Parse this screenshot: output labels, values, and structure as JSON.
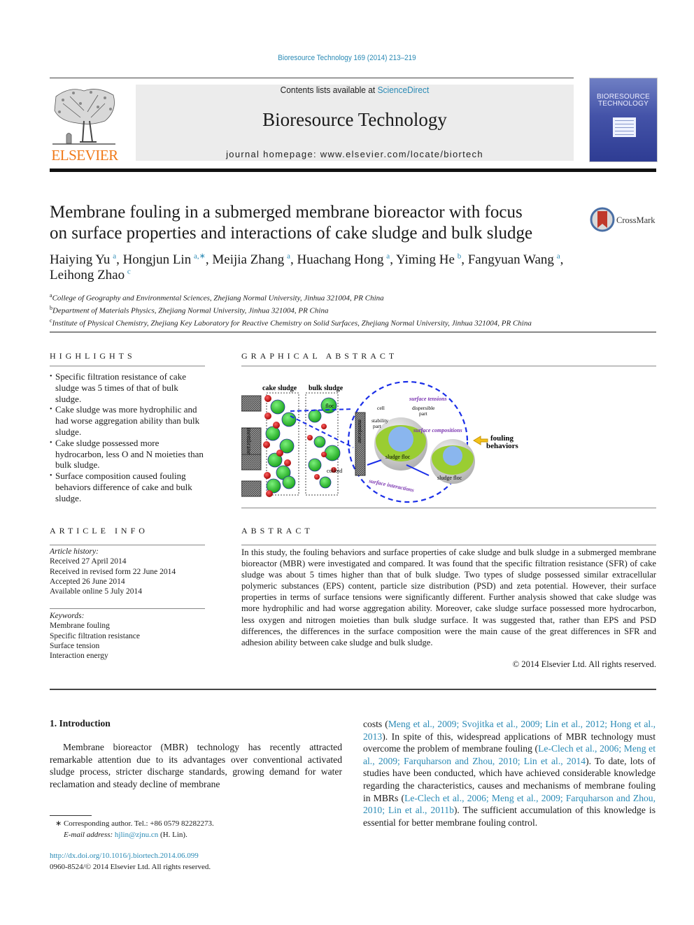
{
  "header": {
    "journal_reference": "Bioresource Technology 169 (2014) 213–219",
    "contents_prefix": "Contents lists available at ",
    "contents_link": "ScienceDirect",
    "journal_title": "Bioresource Technology",
    "homepage": "journal homepage: www.elsevier.com/locate/biortech",
    "publisher_logo": "ELSEVIER",
    "cover_title_line1": "BIORESOURCE",
    "cover_title_line2": "TECHNOLOGY",
    "crossmark_label": "CrossMark"
  },
  "article": {
    "title_line1": "Membrane fouling in a submerged membrane bioreactor with focus",
    "title_line2": "on surface properties and interactions of cake sludge and bulk sludge",
    "authors": [
      {
        "name": "Haiying Yu",
        "sup": "a"
      },
      {
        "name": "Hongjun Lin",
        "sup": "a,∗"
      },
      {
        "name": "Meijia Zhang",
        "sup": "a"
      },
      {
        "name": "Huachang Hong",
        "sup": "a"
      },
      {
        "name": "Yiming He",
        "sup": "b"
      },
      {
        "name": "Fangyuan Wang",
        "sup": "a"
      },
      {
        "name": "Leihong Zhao",
        "sup": "c"
      }
    ],
    "affiliations": [
      {
        "sup": "a",
        "text": "College of Geography and Environmental Sciences, Zhejiang Normal University, Jinhua 321004, PR China"
      },
      {
        "sup": "b",
        "text": "Department of Materials Physics, Zhejiang Normal University, Jinhua 321004, PR China"
      },
      {
        "sup": "c",
        "text": "Institute of Physical Chemistry, Zhejiang Key Laboratory for Reactive Chemistry on Solid Surfaces, Zhejiang Normal University, Jinhua 321004, PR China"
      }
    ]
  },
  "highlights": {
    "heading": "HIGHLIGHTS",
    "items": [
      "Specific filtration resistance of cake sludge was 5 times of that of bulk sludge.",
      "Cake sludge was more hydrophilic and had worse aggregation ability than bulk sludge.",
      "Cake sludge possessed more hydrocarbon, less O and N moieties than bulk sludge.",
      "Surface composition caused fouling behaviors difference of cake and bulk sludge."
    ]
  },
  "graphical_abstract": {
    "heading": "GRAPHICAL ABSTRACT",
    "labels": {
      "cake_sludge": "cake sludge",
      "bulk_sludge": "bulk sludge",
      "membrane": "membrane",
      "floc": "floc",
      "colloid": "colloid",
      "surface_tensions": "surface tensions",
      "cell": "cell",
      "dispersible_part_1": "dispersible",
      "dispersible_part_2": "part",
      "stability_part_1": "stability",
      "stability_part_2": "part",
      "surface_compositions": "surface compositions",
      "sludge_floc": "sludge floc",
      "surface_interactions": "surface interactions",
      "fouling_1": "fouling",
      "fouling_2": "behaviors"
    }
  },
  "article_info": {
    "heading": "ARTICLE INFO",
    "history_label": "Article history:",
    "history": [
      "Received 27 April 2014",
      "Received in revised form 22 June 2014",
      "Accepted 26 June 2014",
      "Available online 5 July 2014"
    ],
    "keywords_label": "Keywords:",
    "keywords": [
      "Membrane fouling",
      "Specific filtration resistance",
      "Surface tension",
      "Interaction energy"
    ]
  },
  "abstract": {
    "heading": "ABSTRACT",
    "text": "In this study, the fouling behaviors and surface properties of cake sludge and bulk sludge in a submerged membrane bioreactor (MBR) were investigated and compared. It was found that the specific filtration resistance (SFR) of cake sludge was about 5 times higher than that of bulk sludge. Two types of sludge possessed similar extracellular polymeric substances (EPS) content, particle size distribution (PSD) and zeta potential. However, their surface properties in terms of surface tensions were significantly different. Further analysis showed that cake sludge was more hydrophilic and had worse aggregation ability. Moreover, cake sludge surface possessed more hydrocarbon, less oxygen and nitrogen moieties than bulk sludge surface. It was suggested that, rather than EPS and PSD differences, the differences in the surface composition were the main cause of the great differences in SFR and adhesion ability between cake sludge and bulk sludge.",
    "copyright": "© 2014 Elsevier Ltd. All rights reserved."
  },
  "introduction": {
    "heading": "1. Introduction",
    "left_text": "Membrane bioreactor (MBR) technology has recently attracted remarkable attention due to its advantages over conventional activated sludge process, stricter discharge standards, growing demand for water reclamation and steady decline of membrane",
    "right_segments": [
      {
        "t": "costs (",
        "link": false
      },
      {
        "t": "Meng et al., 2009; Svojitka et al., 2009; Lin et al., 2012; Hong et al., 2013",
        "link": true
      },
      {
        "t": "). In spite of this, widespread applications of MBR technology must overcome the problem of membrane fouling (",
        "link": false
      },
      {
        "t": "Le-Clech et al., 2006; Meng et al., 2009; Farquharson and Zhou, 2010; Lin et al., 2014",
        "link": true
      },
      {
        "t": "). To date, lots of studies have been conducted, which have achieved considerable knowledge regarding the characteristics, causes and mechanisms of membrane fouling in MBRs (",
        "link": false
      },
      {
        "t": "Le-Clech et al., 2006; Meng et al., 2009; Farquharson and Zhou, 2010; Lin et al., 2011b",
        "link": true
      },
      {
        "t": "). The sufficient accumulation of this knowledge is essential for better membrane fouling control.",
        "link": false
      }
    ]
  },
  "footnote": {
    "marker": "∗",
    "corresponding": "Corresponding author. Tel.: +86 0579 82282273.",
    "email_label": "E-mail address:",
    "email": "hjlin@zjnu.cn",
    "email_suffix": "(H. Lin).",
    "doi": "http://dx.doi.org/10.1016/j.biortech.2014.06.099",
    "issn": "0960-8524/© 2014 Elsevier Ltd. All rights reserved."
  },
  "colors": {
    "link": "#2a8ab5",
    "elsevier_orange": "#f07a1a",
    "ga_blue": "#1a2ee8",
    "ga_purple": "#7a34b0"
  }
}
